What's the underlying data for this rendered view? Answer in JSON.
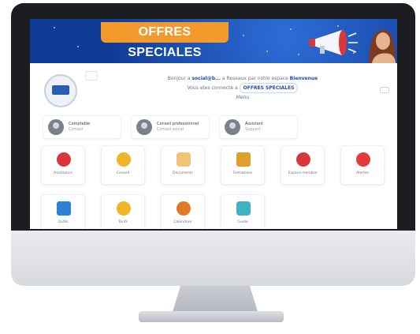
{
  "banner": {
    "title": "OFFRES SPECIALES",
    "accent": "#f39a2d",
    "background": "#1a4fb0"
  },
  "welcome": {
    "line1_prefix": "Bonjour a",
    "line1_email": "social@b...",
    "line1_suffix": "a Reseaux par notre espace",
    "line1_name": "Bienvenue",
    "line2_prefix": "Vous etes connecte a",
    "line2_pill": "OFFRES SPECIALES",
    "line3": "Menu"
  },
  "accounts": [
    {
      "name": "Comptable",
      "sub": "Conseil",
      "icon": "user-avatar-icon"
    },
    {
      "name": "Conseil professionnel",
      "sub": "Conseil social",
      "icon": "user-avatar-icon"
    },
    {
      "name": "Assistant",
      "sub": "Support",
      "icon": "user-avatar-icon"
    }
  ],
  "tiles": [
    {
      "label": "Assistance",
      "icon": "bug-icon",
      "color": "#d9373a"
    },
    {
      "label": "Conseil",
      "icon": "smile-icon",
      "color": "#f0b429"
    },
    {
      "label": "Documents",
      "icon": "bag-icon",
      "color": "#f2c277"
    },
    {
      "label": "Formations",
      "icon": "folder-icon",
      "color": "#e0a030"
    },
    {
      "label": "Espace membre",
      "icon": "target-icon",
      "color": "#d7373a"
    },
    {
      "label": "Alertes",
      "icon": "alert-icon",
      "color": "#e33a3e"
    },
    {
      "label": "Outils",
      "icon": "monitor-icon",
      "color": "#2f7fd6"
    },
    {
      "label": "Tarifs",
      "icon": "pencil-icon",
      "color": "#f0b429"
    },
    {
      "label": "Calendrier",
      "icon": "calendar-icon",
      "color": "#e07a2a"
    },
    {
      "label": "Guide",
      "icon": "chat-icon",
      "color": "#3bb3c3"
    }
  ]
}
